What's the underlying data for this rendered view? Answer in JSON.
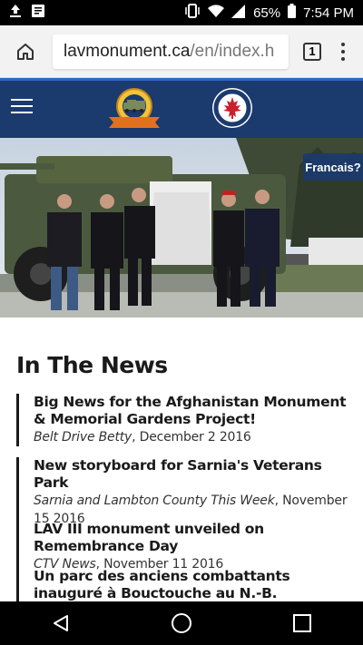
{
  "status_bar": {
    "battery": "65%",
    "time": "7:54 PM"
  },
  "browser": {
    "url_domain": "lavmonument.ca",
    "url_path": "/en/index.h",
    "tab_count": "1"
  },
  "hero": {
    "language_toggle": "Francais?"
  },
  "news": {
    "heading": "In The News",
    "items": [
      {
        "title": "Big News for the Afghanistan Monument & Memorial Gardens Project!",
        "source": "Belt Drive Betty",
        "date": ", December 2 2016"
      },
      {
        "title": "New storyboard for Sarnia's Veterans Park",
        "source": "Sarnia and Lambton County This Week",
        "date": ", November 15 2016"
      },
      {
        "title": "LAV III monument unveiled on Remembrance Day",
        "source": "CTV News",
        "date": ", November 11 2016"
      },
      {
        "title": "Un parc des anciens combattants inauguré à Bouctouche au N.-B.",
        "source": "",
        "date": ""
      }
    ]
  },
  "colors": {
    "header_bg": "#1b3a6e",
    "header_accent": "#2d69c4",
    "logo_orange": "#e2711d"
  },
  "icons": [
    "upload-icon",
    "notification-icon",
    "vibrate-icon",
    "wifi-icon",
    "signal-icon",
    "battery-icon",
    "home-icon",
    "tabs-icon",
    "overflow-menu-icon",
    "hamburger-icon",
    "back-icon",
    "home-circle-icon",
    "recents-icon"
  ]
}
